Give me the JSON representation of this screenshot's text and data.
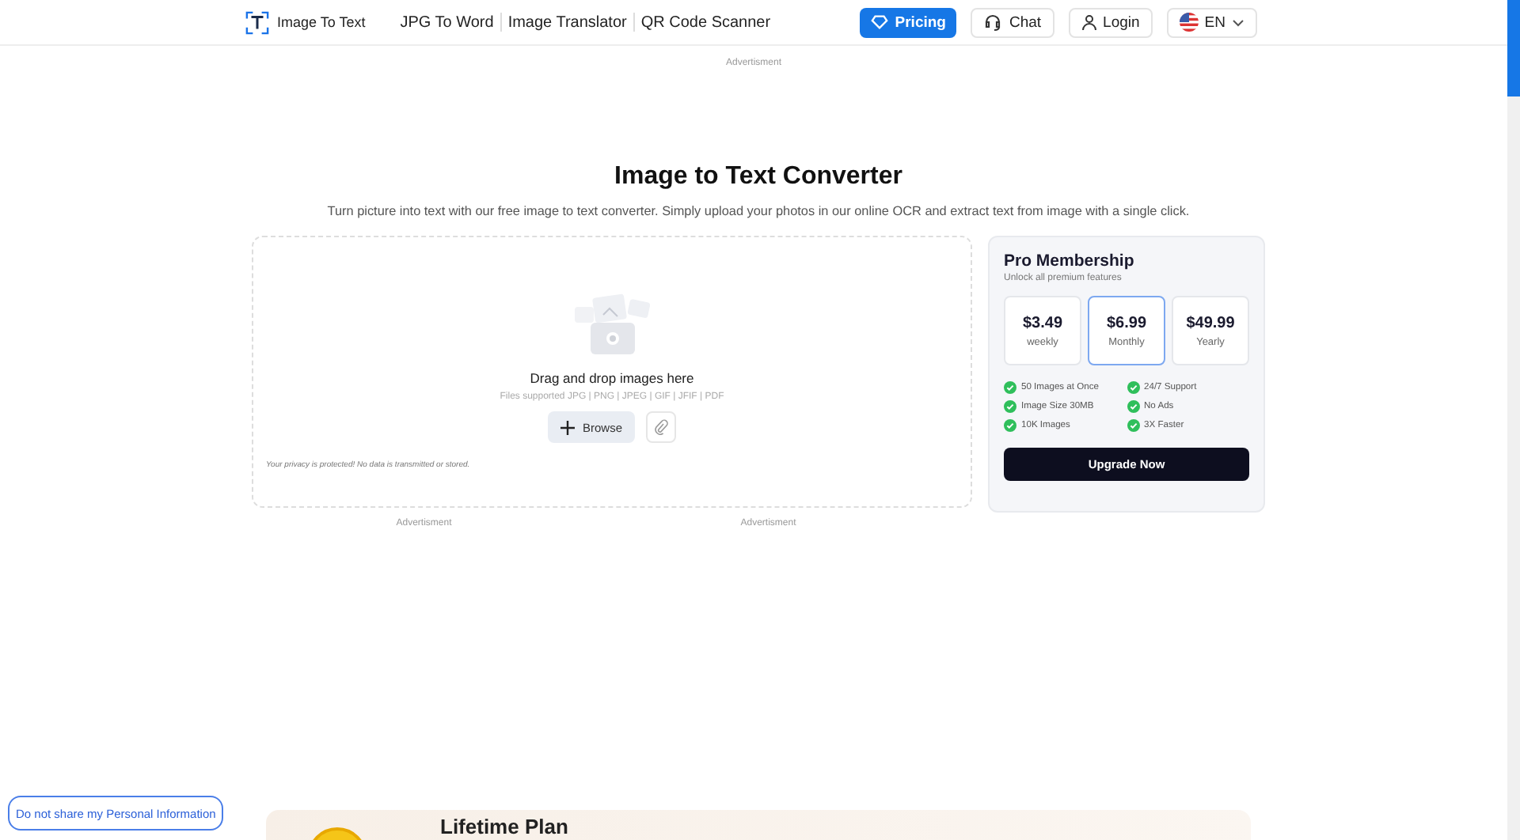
{
  "header": {
    "logo": "Image To Text",
    "nav": [
      "JPG To Word",
      "Image Translator",
      "QR Code Scanner"
    ],
    "pricing": "Pricing",
    "chat": "Chat",
    "login": "Login",
    "language": "EN"
  },
  "top_ad": "Advertisment",
  "title": "Image to Text Converter",
  "subtitle": "Turn picture into text with our free image to text converter. Simply upload your photos in our online OCR and extract text from image with a single click.",
  "upload": {
    "heading": "Drag and drop images here",
    "formats": "Files supported JPG | PNG | JPEG | GIF | JFIF | PDF",
    "browse": "Browse",
    "privacy": "Your privacy is protected! No data is transmitted or stored."
  },
  "ads": [
    "Advertisment",
    "Advertisment"
  ],
  "membership": {
    "title": "Pro Membership",
    "subtitle": "Unlock all premium features",
    "plans": [
      {
        "price": "$3.49",
        "period": "weekly",
        "selected": false
      },
      {
        "price": "$6.99",
        "period": "Monthly",
        "selected": true
      },
      {
        "price": "$49.99",
        "period": "Yearly",
        "selected": false
      }
    ],
    "features": [
      "50 Images at Once",
      "24/7 Support",
      "Image Size 30MB",
      "No Ads",
      "10K Images",
      "3X Faster"
    ],
    "button": "Upgrade Now"
  },
  "privacy_link": "Do not share my Personal Information",
  "lifetime": {
    "title": "Lifetime Plan"
  }
}
